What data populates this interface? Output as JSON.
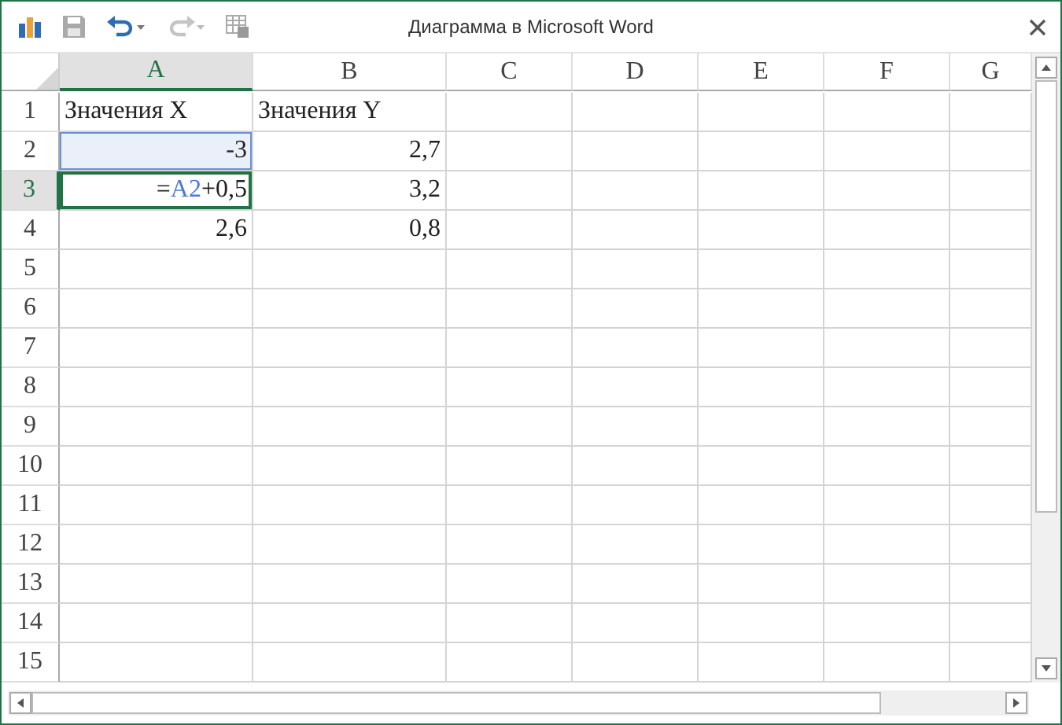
{
  "window": {
    "title": "Диаграмма в Microsoft Word"
  },
  "toolbar": [
    {
      "kind": "chart",
      "disabled": false
    },
    {
      "kind": "save",
      "disabled": true
    },
    {
      "kind": "undo",
      "disabled": false
    },
    {
      "kind": "redo",
      "disabled": true
    },
    {
      "kind": "sheet",
      "disabled": true
    }
  ],
  "columns": [
    {
      "label": "A",
      "selected": true
    },
    {
      "label": "B",
      "selected": false
    },
    {
      "label": "C",
      "selected": false
    },
    {
      "label": "D",
      "selected": false
    },
    {
      "label": "E",
      "selected": false
    },
    {
      "label": "F",
      "selected": false
    },
    {
      "label": "G",
      "selected": false
    }
  ],
  "rows": [
    {
      "label": "1",
      "selected": false,
      "cells": [
        {
          "kind": "text",
          "selected": false,
          "referenced": false,
          "text": "Значения X"
        },
        {
          "kind": "text",
          "selected": false,
          "referenced": false,
          "text": "Значения Y"
        }
      ]
    },
    {
      "label": "2",
      "selected": false,
      "cells": [
        {
          "kind": "number",
          "selected": false,
          "referenced": true,
          "text": "-3"
        },
        {
          "kind": "number",
          "selected": false,
          "referenced": false,
          "text": "2,7"
        }
      ]
    },
    {
      "label": "3",
      "selected": true,
      "cells": [
        {
          "kind": "number",
          "selected": true,
          "referenced": false,
          "parts": [
            {
              "kind": "plain",
              "text": "="
            },
            {
              "kind": "ref",
              "text": "A2"
            },
            {
              "kind": "plain",
              "text": "+0,5"
            }
          ]
        },
        {
          "kind": "number",
          "selected": false,
          "referenced": false,
          "text": "3,2"
        }
      ]
    },
    {
      "label": "4",
      "selected": false,
      "cells": [
        {
          "kind": "number",
          "selected": false,
          "referenced": false,
          "text": "2,6"
        },
        {
          "kind": "number",
          "selected": false,
          "referenced": false,
          "text": "0,8"
        }
      ]
    },
    {
      "label": "5",
      "selected": false
    },
    {
      "label": "6",
      "selected": false
    },
    {
      "label": "7",
      "selected": false
    },
    {
      "label": "8",
      "selected": false
    },
    {
      "label": "9",
      "selected": false
    },
    {
      "label": "10",
      "selected": false
    },
    {
      "label": "11",
      "selected": false
    },
    {
      "label": "12",
      "selected": false
    },
    {
      "label": "13",
      "selected": false
    },
    {
      "label": "14",
      "selected": false
    },
    {
      "label": "15",
      "selected": false
    }
  ]
}
